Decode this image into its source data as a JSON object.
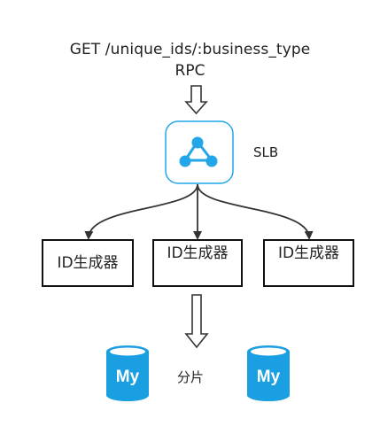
{
  "request": {
    "endpoint": "GET /unique_ids/:business_type",
    "protocol": "RPC"
  },
  "load_balancer": {
    "label": "SLB",
    "icon": "slb-network-icon",
    "accent_color": "#22a6e8"
  },
  "generators": [
    {
      "label": "ID生成器"
    },
    {
      "label": "ID生成器"
    },
    {
      "label": "ID生成器"
    }
  ],
  "databases": {
    "icon_text": "My",
    "color": "#1a9fe2",
    "count": 2
  },
  "sharding_label": "分片"
}
